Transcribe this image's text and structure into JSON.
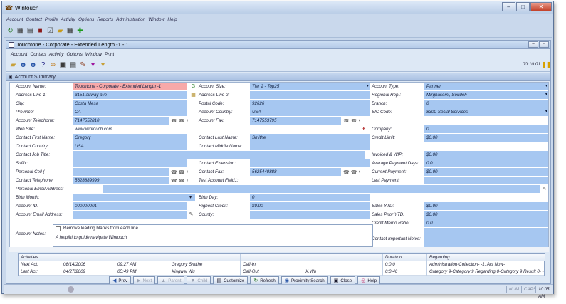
{
  "app": {
    "title": "Wintouch"
  },
  "main_menu": [
    "Account",
    "Contact",
    "Profile",
    "Activity",
    "Options",
    "Reports",
    "Administration",
    "Window",
    "Help"
  ],
  "child_window": {
    "title": "Touchtone - Corporate - Extended Length -1 - 1",
    "menu": [
      "Account",
      "Contact",
      "Activity",
      "Options",
      "Window",
      "Print"
    ],
    "timer": "00:10:01"
  },
  "section_title": "Account Summary",
  "form": {
    "left": [
      {
        "label": "Account Name:",
        "value": "Touchtone - Corporate - Extended Length -1"
      },
      {
        "label": "Address Line-1:",
        "value": "3151 airway ave"
      },
      {
        "label": "City:",
        "value": "Costa Mesa"
      },
      {
        "label": "Province:",
        "value": "CA"
      },
      {
        "label": "Account Telephone:",
        "value": "7147552810"
      },
      {
        "label": "Web Site:",
        "value": "www.wintouch.com"
      },
      {
        "label": "Contact First Name:",
        "value": "Gregory"
      },
      {
        "label": "Contact Country:",
        "value": "USA"
      },
      {
        "label": "Contact Job Title:",
        "value": ""
      },
      {
        "label": "Suffix:",
        "value": ""
      },
      {
        "label": "Personal Cell (",
        "value": ""
      },
      {
        "label": "Contact Telephone:",
        "value": "5628889999"
      },
      {
        "label": "Personal Email Address:",
        "value": ""
      },
      {
        "label": "Birth Month:",
        "value": ""
      },
      {
        "label": "Account ID:",
        "value": "000000001"
      },
      {
        "label": "Account Email Address:",
        "value": ""
      }
    ],
    "middle": [
      {
        "label": "Account Size:",
        "value": "Tier 2 - Top25"
      },
      {
        "label": "Address Line-2:",
        "value": ""
      },
      {
        "label": "Postal Code:",
        "value": "92626"
      },
      {
        "label": "Account Country:",
        "value": "USA"
      },
      {
        "label": "Account Fax:",
        "value": "7147553795"
      },
      {
        "label": "Contact Last Name:",
        "value": "Smithe"
      },
      {
        "label": "Contact Middle Name:",
        "value": ""
      },
      {
        "label": "Contact Extension:",
        "value": ""
      },
      {
        "label": "Contact Fax:",
        "value": "5625440888"
      },
      {
        "label": "Test Account Field1:",
        "value": ""
      },
      {
        "label": "Birth Day:",
        "value": "0"
      },
      {
        "label": "Highest Credit:",
        "value": "$0.00"
      },
      {
        "label": "County:",
        "value": ""
      }
    ],
    "right": [
      {
        "label": "Account Type:",
        "value": "Partner"
      },
      {
        "label": "Regional Rep.:",
        "value": "Mirghasemi, Soudeh"
      },
      {
        "label": "Branch:",
        "value": "0"
      },
      {
        "label": "SIC Code:",
        "value": "8300-Social Services"
      },
      {
        "label": "Company:",
        "value": "0"
      },
      {
        "label": "Credit Limit:",
        "value": "$0.00"
      },
      {
        "label": "Invoiced & WIP:",
        "value": "$0.00"
      },
      {
        "label": "Average Payment Days:",
        "value": "0.0"
      },
      {
        "label": "Current Payment:",
        "value": "$0.00"
      },
      {
        "label": "Last Payment:",
        "value": ""
      },
      {
        "label": "Sales YTD:",
        "value": "$0.00"
      },
      {
        "label": "Sales Prior YTD:",
        "value": "$0.00"
      },
      {
        "label": "Credit Memo Ratio:",
        "value": "0.0"
      },
      {
        "label": "Contact Important Notes:",
        "value": ""
      }
    ],
    "notes": {
      "label": "Account Notes:",
      "checkbox_label": "Remove leading blanks from each line",
      "text": "A helpful to guide navigate Wintouch"
    }
  },
  "activities": {
    "headers": [
      "Activities",
      "",
      "",
      "",
      "",
      "",
      "Duration",
      "Regarding"
    ],
    "rows": [
      [
        "Next Act:",
        "08/14/2006",
        "09:27 AM",
        "Gregory Smithe",
        "Call-In",
        "",
        "0:0:0",
        "Administration-Collection- -1. Act Now-"
      ],
      [
        "Last Act:",
        "04/27/2009",
        "05:49 PM",
        "Xingwei Wu",
        "Call-Out",
        "X.Wu",
        "0:0:46",
        "Category 9-Category 9 Regarding 0-Category 9 Result 0- -"
      ]
    ]
  },
  "buttons": [
    {
      "label": "Prev",
      "icon": "arrow-left-icon",
      "disabled": false
    },
    {
      "label": "Next",
      "icon": "arrow-right-icon",
      "disabled": true
    },
    {
      "label": "Parent",
      "icon": "parent-icon",
      "disabled": true
    },
    {
      "label": "Child",
      "icon": "child-icon",
      "disabled": true
    },
    {
      "label": "Customize",
      "icon": "customize-icon",
      "disabled": false
    },
    {
      "label": "Refresh",
      "icon": "refresh-icon",
      "disabled": false
    },
    {
      "label": "Proximity Search",
      "icon": "proximity-icon",
      "disabled": false
    },
    {
      "label": "Close",
      "icon": "close-icon",
      "disabled": false
    },
    {
      "label": "Help",
      "icon": "help-icon",
      "disabled": false
    }
  ],
  "status": {
    "num": "NUM",
    "caps": "CAPS",
    "time": "10:05 AM"
  }
}
